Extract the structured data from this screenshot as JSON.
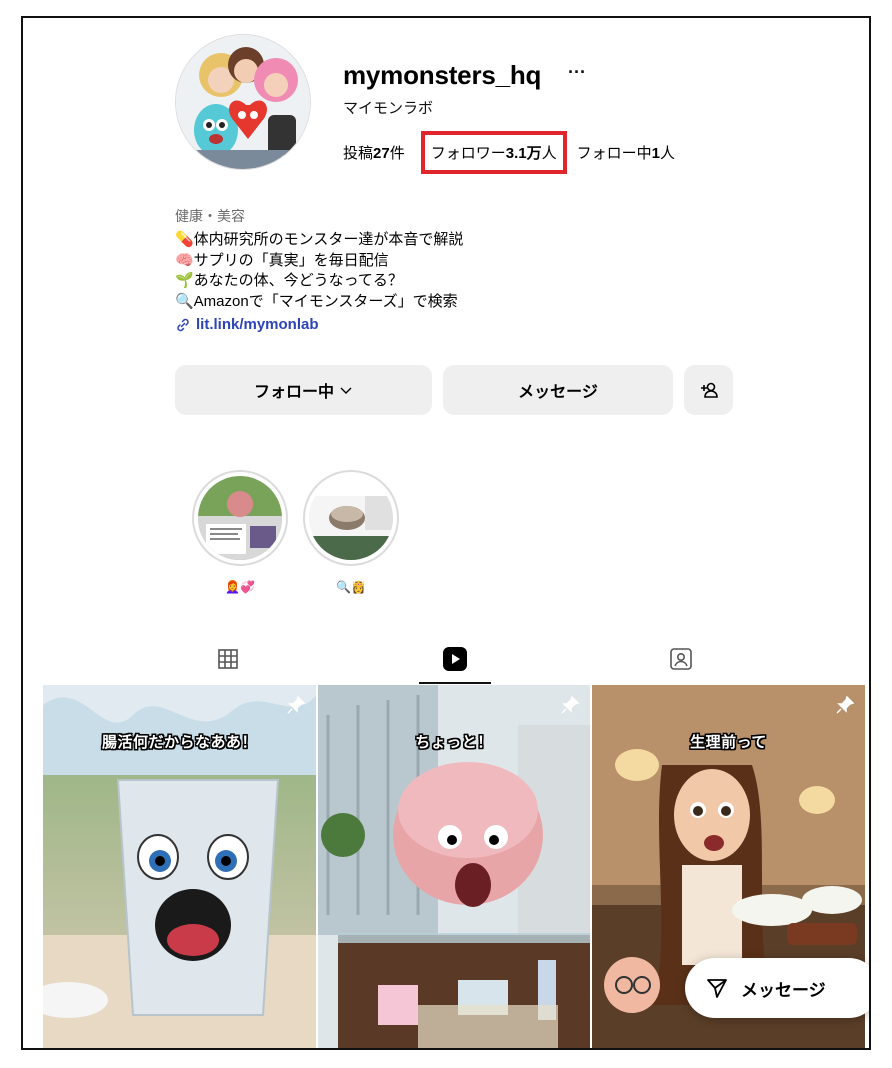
{
  "profile": {
    "username": "mymonsters_hq",
    "more": "···",
    "display_name": "マイモンラボ",
    "stats": {
      "posts_prefix": "投稿",
      "posts_value": "27",
      "posts_suffix": "件",
      "followers_prefix": "フォロワー",
      "followers_value": "3.1万",
      "followers_suffix": "人",
      "following_prefix": "フォロー中",
      "following_value": "1",
      "following_suffix": "人"
    },
    "category": "健康・美容",
    "bio": [
      "💊体内研究所のモンスター達が本音で解説",
      "🧠サプリの「真実」を毎日配信",
      "🌱あなたの体、今どうなってる？",
      "🔍Amazonで「マイモンスターズ」で検索"
    ],
    "link": "lit.link/mymonlab"
  },
  "buttons": {
    "following": "フォロー中",
    "message": "メッセージ"
  },
  "highlights": [
    {
      "label": "👩‍🦰💞"
    },
    {
      "label": "🔍👸"
    }
  ],
  "reels": [
    {
      "caption": "腸活何だからなああ！"
    },
    {
      "caption": "ちょっと！"
    },
    {
      "caption": "生理前って"
    }
  ],
  "floating_message": {
    "label": "メッセージ"
  },
  "colors": {
    "highlight_box": "#e0252d",
    "link": "#2d43b8",
    "button_bg": "#efefef"
  }
}
